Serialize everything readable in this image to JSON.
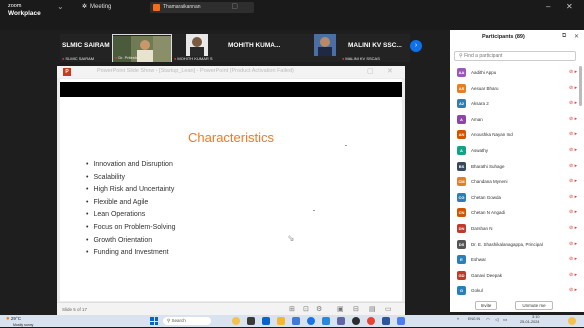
{
  "window": {
    "brand_line1": "zoom",
    "brand_line2": "Workplace",
    "meeting_label": "Meeting",
    "share_label": "Thamaraikannan"
  },
  "participants_strip": [
    {
      "name": "SLMIC SAIRAM",
      "sub": "SLMIC SAIRAM"
    },
    {
      "name": "",
      "sub": "Dr. Pritesh..."
    },
    {
      "name": "MOHITH KUMA...",
      "sub": "MOHITH KUMAR S"
    },
    {
      "name": "MALINI KV SSC...",
      "sub": "MALINI KV SSCAS"
    }
  ],
  "ppt": {
    "window_title": "PowerPoint Slide Show - [Startup_Lean] - PowerPoint (Product Activation Failed)",
    "slide_title": "Characteristics",
    "bullets": [
      "Innovation and Disruption",
      "Scalability",
      "High Risk and Uncertainty",
      "Flexible and Agile",
      "Lean Operations",
      "Focus on Problem-Solving",
      "Growth Orientation",
      "Funding and Investment"
    ],
    "status_text": "Slide 5 of 17"
  },
  "panel": {
    "title": "Participants (89)",
    "search_placeholder": "Find a participant",
    "participants": [
      {
        "initials": "AA",
        "name": "Aadithi Appu",
        "color": "#9b59b6"
      },
      {
        "initials": "AS",
        "name": "Aesuar Bharu",
        "color": "#e67e22"
      },
      {
        "initials": "A2",
        "name": "Aksara 2",
        "color": "#2980b9"
      },
      {
        "initials": "A",
        "name": "Aman",
        "color": "#8e44ad"
      },
      {
        "initials": "AN",
        "name": "Anoushka Nayan Ind",
        "color": "#d35400"
      },
      {
        "initials": "A",
        "name": "Aswathy",
        "color": "#16a085"
      },
      {
        "initials": "BS",
        "name": "Bharathi Suhage",
        "color": "#34495e"
      },
      {
        "initials": "CM",
        "name": "Chandana Myneni",
        "color": "#e67e22"
      },
      {
        "initials": "CG",
        "name": "Chetan Gowda",
        "color": "#2980b9"
      },
      {
        "initials": "CN",
        "name": "Chetan N Angadi",
        "color": "#d35400"
      },
      {
        "initials": "DN",
        "name": "Darshan N",
        "color": "#c0392b"
      },
      {
        "initials": "DS",
        "name": "Dr. E. Shashikalanagappa, Principal",
        "color": "#555555"
      },
      {
        "initials": "E",
        "name": "Eshwar",
        "color": "#2980b9"
      },
      {
        "initials": "GD",
        "name": "Ganavi Deepak",
        "color": "#c0392b"
      },
      {
        "initials": "G",
        "name": "Gokul",
        "color": "#2980b9"
      }
    ],
    "invite_label": "Invite",
    "unmute_label": "Unmute me"
  },
  "taskbar": {
    "temp": "29°C",
    "weather": "Mostly sunny",
    "search": "Search",
    "lang": "ENG IN",
    "time": "3:10",
    "date": "25-01-2024"
  }
}
